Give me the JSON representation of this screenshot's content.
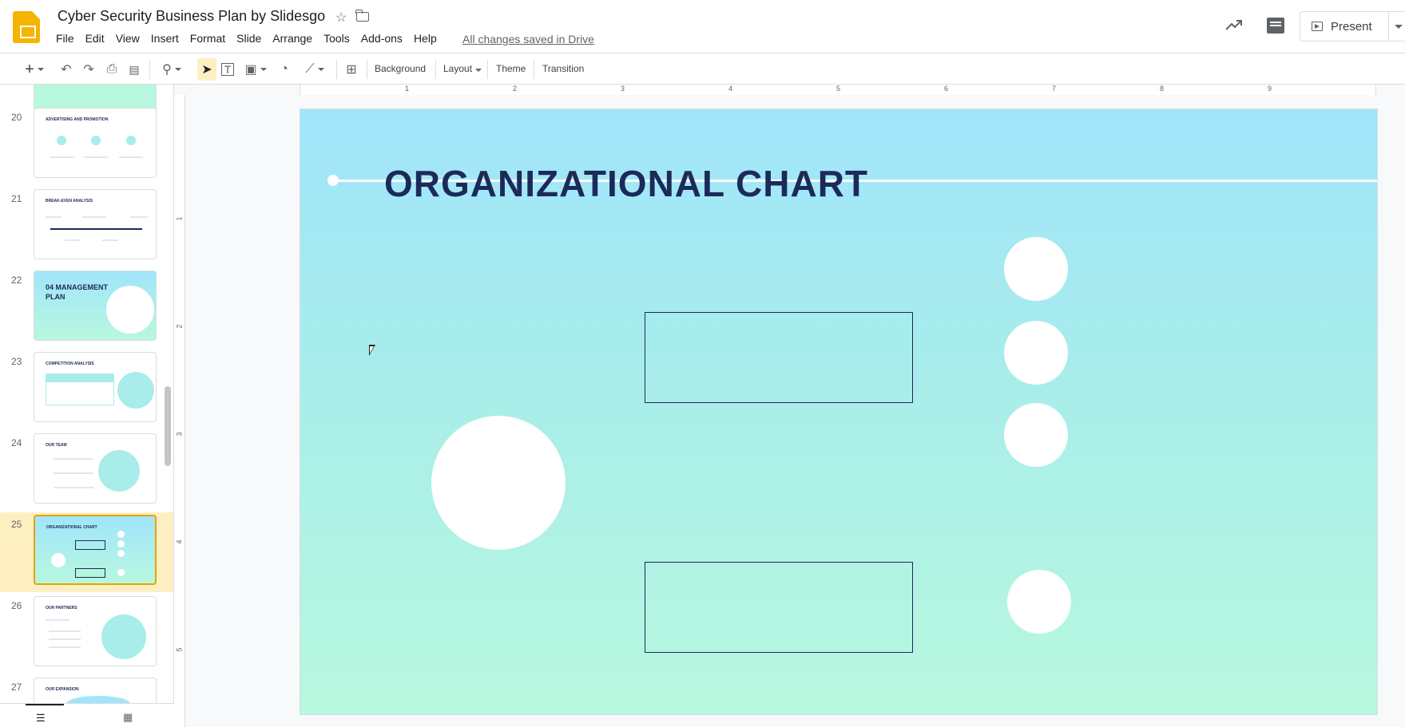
{
  "app": {
    "doc_title": "Cyber Security Business Plan by Slidesgo",
    "save_status": "All changes saved in Drive",
    "present_label": "Present"
  },
  "menu": [
    "File",
    "Edit",
    "View",
    "Insert",
    "Format",
    "Slide",
    "Arrange",
    "Tools",
    "Add-ons",
    "Help"
  ],
  "toolbar": {
    "background": "Background",
    "layout": "Layout",
    "theme": "Theme",
    "transition": "Transition"
  },
  "ruler": {
    "h": [
      "1",
      "2",
      "3",
      "4",
      "5",
      "6",
      "7",
      "8",
      "9"
    ],
    "v": [
      "1",
      "2",
      "3",
      "4",
      "5"
    ]
  },
  "filmstrip": {
    "slides": [
      {
        "num": "20",
        "title": "ADVERTISING AND PROMOTION"
      },
      {
        "num": "21",
        "title": "BREAK-EVEN ANALYSIS"
      },
      {
        "num": "22",
        "title": "04 MANAGEMENT PLAN"
      },
      {
        "num": "23",
        "title": "COMPETITION ANALYSIS"
      },
      {
        "num": "24",
        "title": "OUR TEAM"
      },
      {
        "num": "25",
        "title": "ORGANIZATIONAL CHART"
      },
      {
        "num": "26",
        "title": "OUR PARTNERS"
      },
      {
        "num": "27",
        "title": "OUR EXPANSION"
      }
    ],
    "active_slide": "25"
  },
  "slide": {
    "title": "ORGANIZATIONAL CHART"
  },
  "colors": {
    "accent": "#f4b400",
    "navy": "#1c2a5a",
    "active_row": "#feefc3",
    "slide_top": "#a1e5fb",
    "slide_bottom": "#b8f8de"
  }
}
